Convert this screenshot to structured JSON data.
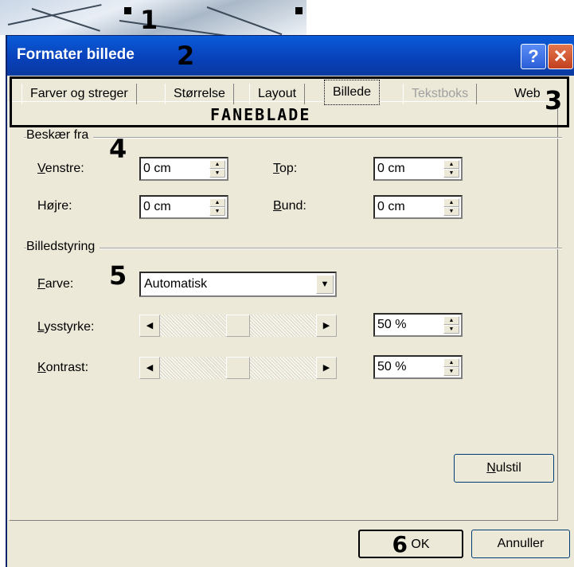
{
  "dialog": {
    "title": "Formater billede",
    "help_label": "?",
    "close_label": "✕"
  },
  "callouts": {
    "n1": "1",
    "n2": "2",
    "n3": "3",
    "n4": "4",
    "n5": "5",
    "n6": "6",
    "tab_area_label": "FANEBLADE"
  },
  "tabs": [
    {
      "label": "Farver og streger",
      "state": "normal"
    },
    {
      "label": "Størrelse",
      "state": "normal"
    },
    {
      "label": "Layout",
      "state": "normal"
    },
    {
      "label": "Billede",
      "state": "selected"
    },
    {
      "label": "Tekstboks",
      "state": "disabled"
    },
    {
      "label": "Web",
      "state": "normal"
    }
  ],
  "crop": {
    "group_title": "Beskær fra",
    "left": {
      "label_accel": "V",
      "label_rest": "enstre:",
      "value": "0 cm"
    },
    "right": {
      "label_accel": "",
      "label_rest": "Højre:",
      "value": "0 cm"
    },
    "top": {
      "label_accel": "T",
      "label_rest": "op:",
      "value": "0 cm"
    },
    "bottom": {
      "label_accel": "B",
      "label_rest": "und:",
      "value": "0 cm"
    }
  },
  "image_control": {
    "group_title": "Billedstyring",
    "color": {
      "label_accel": "F",
      "label_rest": "arve:",
      "value": "Automatisk"
    },
    "brightness": {
      "label_accel": "L",
      "label_rest": "ysstyrke:",
      "value": "50 %",
      "level": 0.5
    },
    "contrast": {
      "label_accel": "K",
      "label_rest": "ontrast:",
      "value": "50 %",
      "level": 0.5
    }
  },
  "buttons": {
    "reset_accel": "N",
    "reset_rest": "ulstil",
    "ok": "OK",
    "cancel": "Annuller"
  },
  "colors": {
    "titlebar": "#0a4fd0",
    "dialog_bg": "#ece9d8",
    "close": "#d9532c"
  }
}
